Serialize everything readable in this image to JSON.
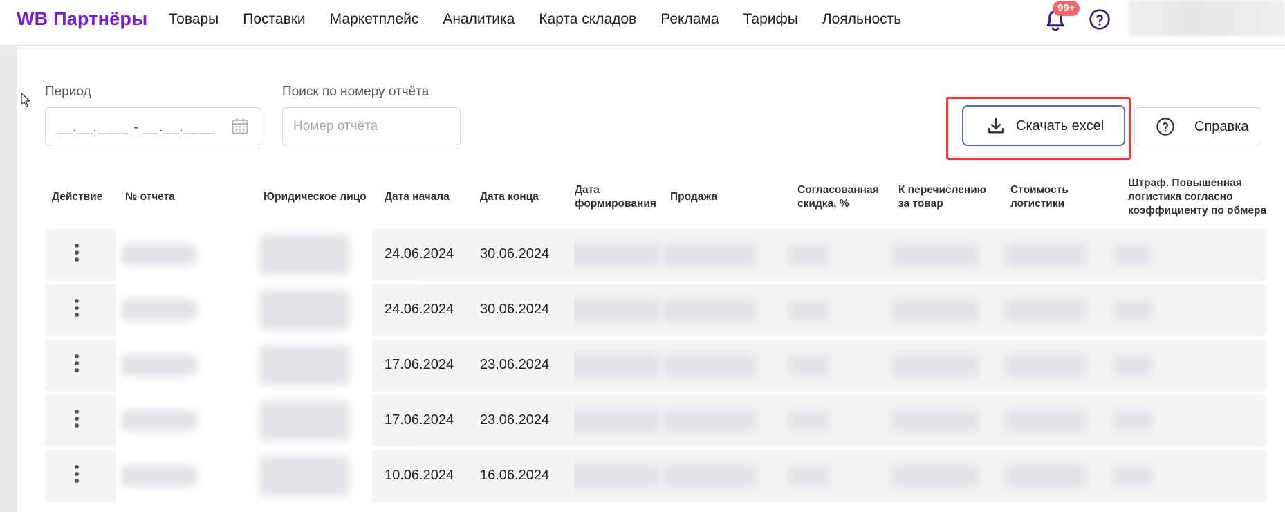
{
  "header": {
    "logo": "WB Партнёры",
    "nav": [
      "Товары",
      "Поставки",
      "Маркетплейс",
      "Аналитика",
      "Карта складов",
      "Реклама",
      "Тарифы",
      "Лояльность"
    ],
    "notifications_badge": "99+"
  },
  "filters": {
    "period_label": "Период",
    "period_value": "__.__.____ - __.__.____",
    "search_label": "Поиск по номеру отчёта",
    "search_placeholder": "Номер отчёта"
  },
  "actions": {
    "download_label": "Скачать excel",
    "help_label": "Справка"
  },
  "table": {
    "headers": {
      "action": "Действие",
      "report_no": "№ отчета",
      "legal_entity": "Юридическое лицо",
      "start_date": "Дата начала",
      "end_date": "Дата конца",
      "formed_1": "Дата",
      "formed_2": "формирования",
      "sale": "Продажа",
      "discount_1": "Согласованная",
      "discount_2": "скидка, %",
      "transfer_1": "К перечислению",
      "transfer_2": "за товар",
      "logistics_1": "Стоимость",
      "logistics_2": "логистики",
      "fine_1": "Штраф. Повышенная",
      "fine_2": "логистика согласно",
      "fine_3": "коэффициенту по обмера"
    },
    "rows": [
      {
        "start": "24.06.2024",
        "end": "30.06.2024"
      },
      {
        "start": "24.06.2024",
        "end": "30.06.2024"
      },
      {
        "start": "17.06.2024",
        "end": "23.06.2024"
      },
      {
        "start": "17.06.2024",
        "end": "23.06.2024"
      },
      {
        "start": "10.06.2024",
        "end": "16.06.2024"
      }
    ]
  },
  "colors": {
    "brand": "#7a1fc9",
    "accent_button_border": "#5d63c9",
    "highlight": "#e0403a",
    "badge": "#f0646a",
    "row_bg": "#f4f4f6"
  },
  "icons": [
    "bell-icon",
    "help-circle-icon",
    "calendar-icon",
    "download-icon",
    "kebab-menu-icon",
    "mouse-cursor-icon"
  ]
}
